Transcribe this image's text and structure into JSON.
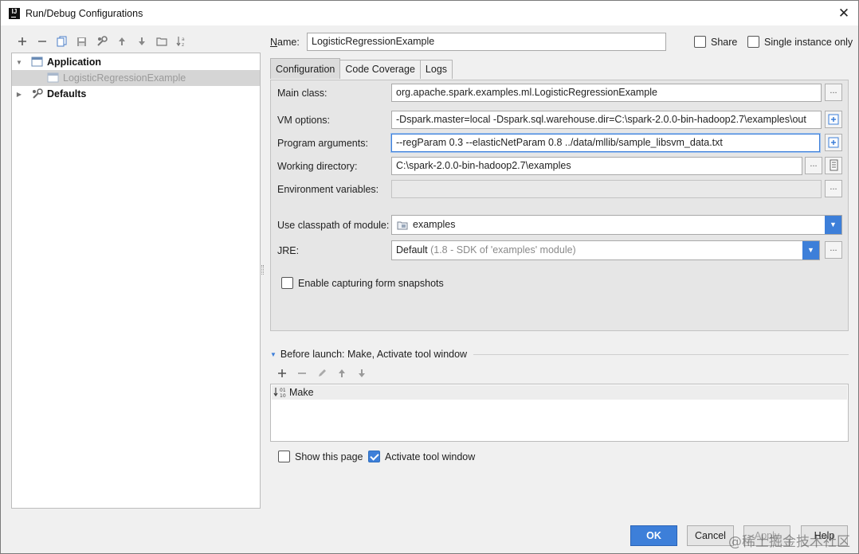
{
  "window": {
    "title": "Run/Debug Configurations",
    "app_icon_text": "IJ"
  },
  "tree": {
    "items": [
      {
        "label": "Application"
      },
      {
        "label": "LogisticRegressionExample"
      },
      {
        "label": "Defaults"
      }
    ]
  },
  "form": {
    "name_label": "Name:",
    "name_value": "LogisticRegressionExample",
    "share_label": "Share",
    "single_instance_label": "Single instance only",
    "share_checked": false,
    "single_instance_checked": false
  },
  "tabs": [
    "Configuration",
    "Code Coverage",
    "Logs"
  ],
  "config": {
    "main_class_label": "Main class:",
    "main_class_value": "org.apache.spark.examples.ml.LogisticRegressionExample",
    "vm_options_label": "VM options:",
    "vm_options_value": "-Dspark.master=local -Dspark.sql.warehouse.dir=C:\\spark-2.0.0-bin-hadoop2.7\\examples\\out",
    "program_args_label": "Program arguments:",
    "program_args_value": "--regParam 0.3 --elasticNetParam 0.8 ../data/mllib/sample_libsvm_data.txt",
    "working_dir_label": "Working directory:",
    "working_dir_value": "C:\\spark-2.0.0-bin-hadoop2.7\\examples",
    "env_vars_label": "Environment variables:",
    "env_vars_value": "",
    "classpath_label": "Use classpath of module:",
    "classpath_value": "examples",
    "jre_label": "JRE:",
    "jre_value": "Default",
    "jre_detail": "(1.8 - SDK of 'examples' module)",
    "snapshots_label": "Enable capturing form snapshots",
    "snapshots_checked": false,
    "dots": "..."
  },
  "before_launch": {
    "header": "Before launch: Make, Activate tool window",
    "items": [
      "Make"
    ]
  },
  "footer": {
    "show_page_label": "Show this page",
    "show_page_checked": false,
    "activate_tool_label": "Activate tool window",
    "activate_tool_checked": true
  },
  "buttons": {
    "ok": "OK",
    "cancel": "Cancel",
    "apply": "Apply",
    "help": "Help"
  },
  "watermark": "@稀土掘金技术社区",
  "colors": {
    "accent": "#3d7fd9",
    "selection": "#d5d5d5"
  }
}
